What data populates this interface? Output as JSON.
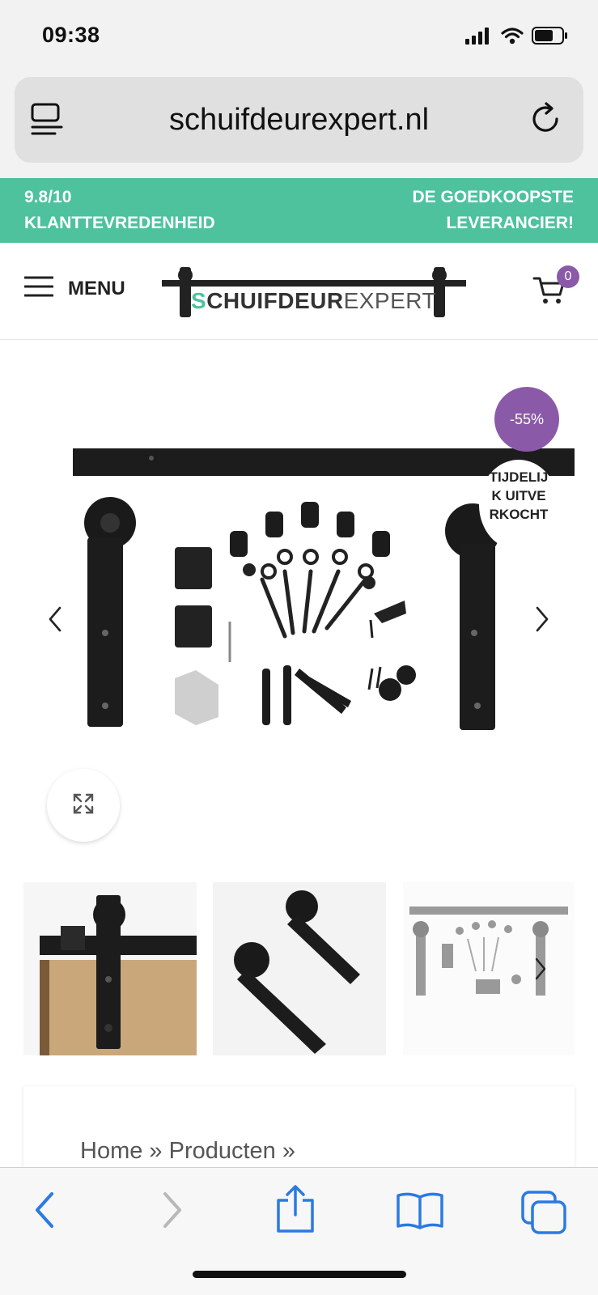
{
  "status_bar": {
    "time": "09:38",
    "icons": [
      "signal-icon",
      "wifi-icon",
      "battery-icon"
    ]
  },
  "browser": {
    "url": "schuifdeurexpert.nl"
  },
  "banner": {
    "left_line1": "9.8/10",
    "left_line2": "KLANTTEVREDENHEID",
    "right_line1": "DE GOEDKOOPSTE",
    "right_line2": "LEVERANCIER!",
    "color": "#4dc29c"
  },
  "header": {
    "menu_label": "MENU",
    "logo": {
      "part_s": "S",
      "part_bold": "CHUIFDEUR",
      "part_light": "EXPERT"
    },
    "cart_count": "0",
    "badge_color": "#8a5aa8"
  },
  "product": {
    "sale_badge": "-55%",
    "stock_badge": "TIJDELIJK UITVERKOCHT",
    "thumbnails": [
      "thumbnail-door-rail",
      "thumbnail-rollers",
      "thumbnail-kit"
    ]
  },
  "breadcrumb": {
    "text": "Home » Producten »"
  },
  "toolbar": {
    "icons": [
      "back-icon",
      "forward-icon",
      "share-icon",
      "bookmarks-icon",
      "tabs-icon"
    ],
    "accent": "#2a7ae2"
  }
}
